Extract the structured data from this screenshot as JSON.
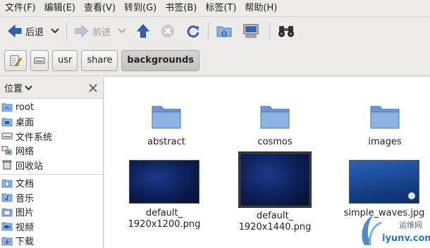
{
  "menubar": {
    "items": [
      "文件(F)",
      "编辑(E)",
      "查看(V)",
      "转到(G)",
      "书签(B)",
      "标签(T)",
      "帮助(H)"
    ]
  },
  "toolbar": {
    "back_label": "后退",
    "forward_label": "前进",
    "icons": [
      "back-arrow-icon",
      "dropdown-icon",
      "forward-arrow-icon",
      "up-arrow-icon",
      "stop-icon",
      "reload-icon",
      "home-folder-icon",
      "computer-icon",
      "binoculars-icon"
    ]
  },
  "location": {
    "crumbs": [
      "usr",
      "share",
      "backgrounds"
    ],
    "active": "backgrounds"
  },
  "sidebar": {
    "title": "位置",
    "group1": [
      "root",
      "桌面",
      "文件系统",
      "网络",
      "回收站"
    ],
    "group2": [
      "文档",
      "音乐",
      "图片",
      "视频",
      "下载"
    ]
  },
  "files": {
    "folders": [
      "abstract",
      "cosmos",
      "images"
    ],
    "images": [
      {
        "name_line1": "default_",
        "name_line2": "1920x1200.png"
      },
      {
        "name_line1": "default_",
        "name_line2": "1920x1440.png"
      },
      {
        "name_line1": "simple_waves.jpg",
        "name_line2": ""
      }
    ]
  },
  "watermark": {
    "line1": "运维网",
    "line2": "iyunv.com"
  },
  "colors": {
    "folder": "#7fa6d8",
    "accent": "#3b6fc2",
    "thumb_blue": "#0b1c50"
  }
}
